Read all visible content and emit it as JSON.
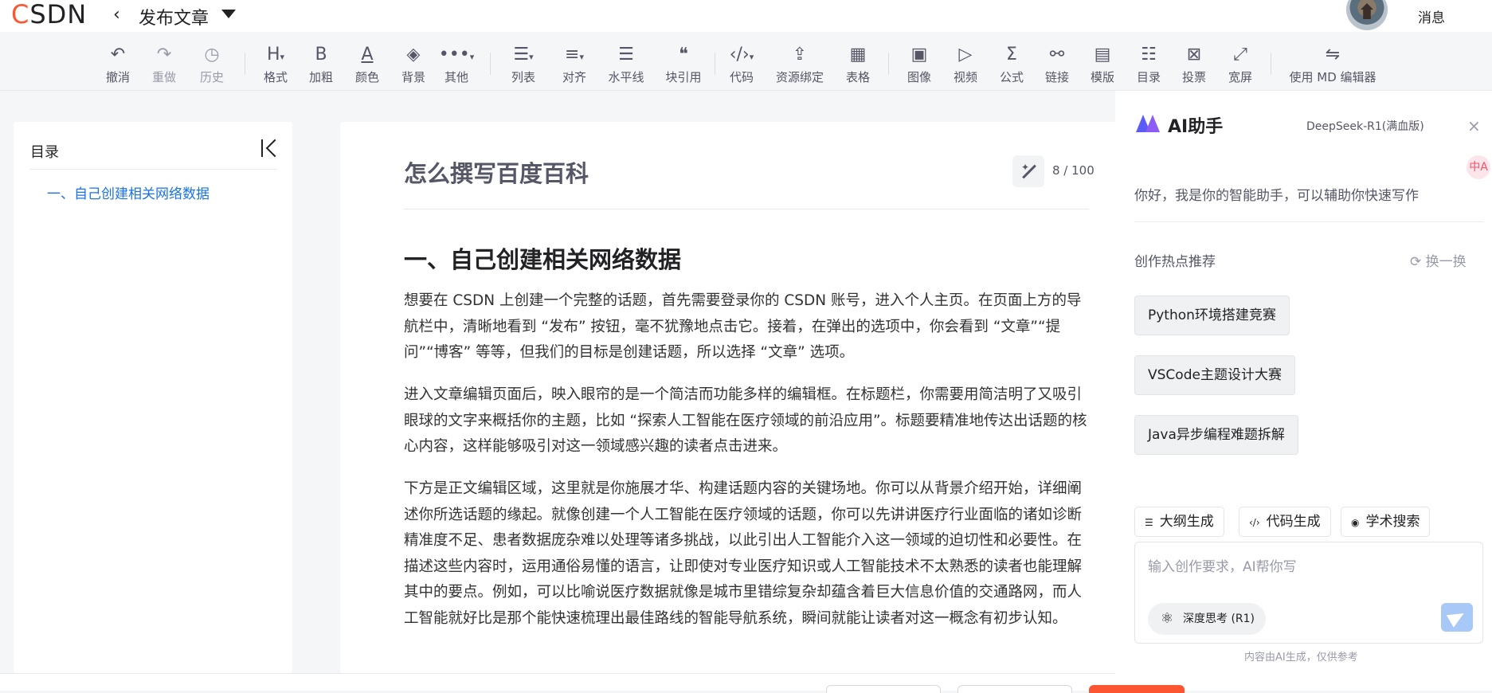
{
  "topbar": {
    "logo_c": "C",
    "logo_rest": "SDN",
    "back_glyph": "‹",
    "page_title": "发布文章",
    "messages": "消息"
  },
  "toolbar": {
    "undo": "撤消",
    "redo": "重做",
    "history": "历史",
    "format": "格式",
    "bold": "加粗",
    "color": "颜色",
    "background": "背景",
    "other": "其他",
    "list": "列表",
    "align": "对齐",
    "hr": "水平线",
    "quote": "块引用",
    "code": "代码",
    "resource": "资源绑定",
    "table": "表格",
    "image": "图像",
    "video": "视频",
    "formula": "公式",
    "link": "链接",
    "template": "模版",
    "toc": "目录",
    "vote": "投票",
    "wide": "宽屏",
    "md": "使用 MD 编辑器"
  },
  "toc": {
    "title": "目录",
    "items": [
      "一、自己创建相关网络数据"
    ]
  },
  "editor": {
    "title": "怎么撰写百度百科",
    "counter": "8 / 100",
    "heading": "一、自己创建相关网络数据",
    "paragraphs": [
      "想要在 CSDN 上创建一个完整的话题，首先需要登录你的 CSDN 账号，进入个人主页。在页面上方的导航栏中，清晰地看到 “发布” 按钮，毫不犹豫地点击它。接着，在弹出的选项中，你会看到 “文章”“提问”“博客” 等等，但我们的目标是创建话题，所以选择 “文章” 选项。",
      "进入文章编辑页面后，映入眼帘的是一个简洁而功能多样的编辑框。在标题栏，你需要用简洁明了又吸引眼球的文字来概括你的主题，比如 “探索人工智能在医疗领域的前沿应用”。标题要精准地传达出话题的核心内容，这样能够吸引对这一领域感兴趣的读者点击进来。",
      "下方是正文编辑区域，这里就是你施展才华、构建话题内容的关键场地。你可以从背景介绍开始，详细阐述你所选话题的缘起。就像创建一个人工智能在医疗领域的话题，你可以先讲讲医疗行业面临的诸如诊断精准度不足、患者数据庞杂难以处理等诸多挑战，以此引出人工智能介入这一领域的迫切性和必要性。在描述这些内容时，运用通俗易懂的语言，让即使对专业医疗知识或人工智能技术不太熟悉的读者也能理解其中的要点。例如，可以比喻说医疗数据就像是城市里错综复杂却蕴含着巨大信息价值的交通路网，而人工智能就好比是那个能快速梳理出最佳路线的智能导航系统，瞬间就能让读者对这一概念有初步认知。"
    ]
  },
  "ai": {
    "title": "AI助手",
    "model": "DeepSeek-R1(满血版)",
    "close": "×",
    "greeting": "你好，我是你的智能助手，可以辅助你快速写作",
    "hot_title": "创作热点推荐",
    "refresh": "换一换",
    "chips": [
      "Python环境搭建竞赛",
      "VSCode主题设计大赛",
      "Java异步编程难题拆解"
    ],
    "actions": [
      "大纲生成",
      "代码生成",
      "学术搜索"
    ],
    "input_placeholder": "输入创作要求，AI帮你写",
    "deep_think": "深度思考 (R1)",
    "footer": "内容由AI生成，仅供参考",
    "side_badge": "中A"
  },
  "colors": {
    "brand": "#fc5531",
    "link": "#1a73e8",
    "ai_accent": "#5b5bf7"
  }
}
